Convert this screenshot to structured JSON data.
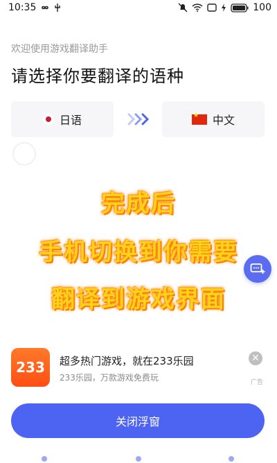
{
  "status_bar": {
    "time": "10:35",
    "battery": "100"
  },
  "header": {
    "subtitle": "欢迎使用游戏翻译助手",
    "title": "请选择你要翻译的语种"
  },
  "languages": {
    "source": {
      "label": "日语",
      "flag_icon": "japan-flag-icon"
    },
    "target": {
      "label": "中文",
      "flag_icon": "china-flag-icon"
    },
    "swap_icon": "chevrons-right-icon"
  },
  "overlay": {
    "line1": "完成后",
    "line2": "手机切换到你需要",
    "line3": "翻译到游戏界面",
    "color": "#ffd21c"
  },
  "ad": {
    "logo_text": "233",
    "title": "超多热门游戏，就在233乐园",
    "subtitle": "233乐园，万款游戏免费玩",
    "badge": "广告"
  },
  "actions": {
    "close_float_label": "关闭浮窗"
  },
  "colors": {
    "accent": "#4d63f1",
    "ad_orange": "#ff5a1a"
  }
}
